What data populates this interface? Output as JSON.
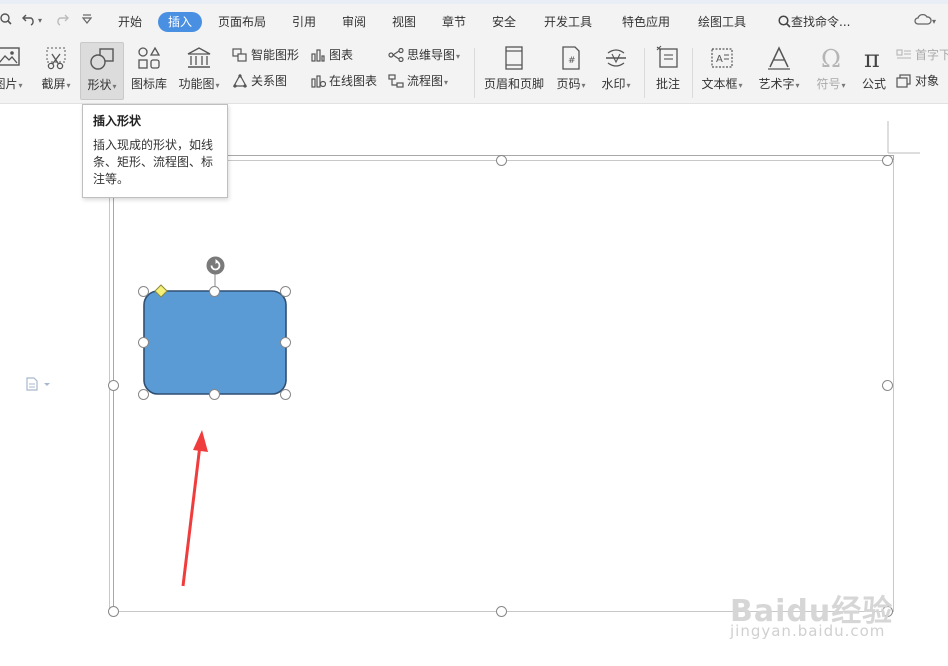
{
  "tabs": [
    {
      "label": "开始",
      "active": false
    },
    {
      "label": "插入",
      "active": true
    },
    {
      "label": "页面布局",
      "active": false
    },
    {
      "label": "引用",
      "active": false
    },
    {
      "label": "审阅",
      "active": false
    },
    {
      "label": "视图",
      "active": false
    },
    {
      "label": "章节",
      "active": false
    },
    {
      "label": "安全",
      "active": false
    },
    {
      "label": "开发工具",
      "active": false
    },
    {
      "label": "特色应用",
      "active": false
    },
    {
      "label": "绘图工具",
      "active": false
    }
  ],
  "search": {
    "label": "查找命令..."
  },
  "ribbon": {
    "picture": "图片",
    "screenshot": "截屏",
    "shapes": "形状",
    "icon_library": "图标库",
    "function_chart": "功能图",
    "smart_graphic": "智能图形",
    "chart": "图表",
    "mind_map": "思维导图",
    "relationship": "关系图",
    "online_chart": "在线图表",
    "flowchart": "流程图",
    "header_footer": "页眉和页脚",
    "page_number": "页码",
    "watermark": "水印",
    "comment": "批注",
    "text_box": "文本框",
    "word_art": "艺术字",
    "symbol": "符号",
    "formula": "公式",
    "drop_cap": "首字下",
    "object": "对象"
  },
  "tooltip": {
    "title": "插入形状",
    "body": "插入现成的形状，如线条、矩形、流程图、标注等。"
  },
  "watermark": {
    "text": "Baidu经验",
    "url": "jingyan.baidu.com"
  },
  "colors": {
    "accent": "#4a90e2",
    "shape_fill": "#5b9bd5",
    "shape_border": "#2f4f73",
    "arrow": "#f03c3c",
    "adjust_handle": "#f5f07a"
  }
}
